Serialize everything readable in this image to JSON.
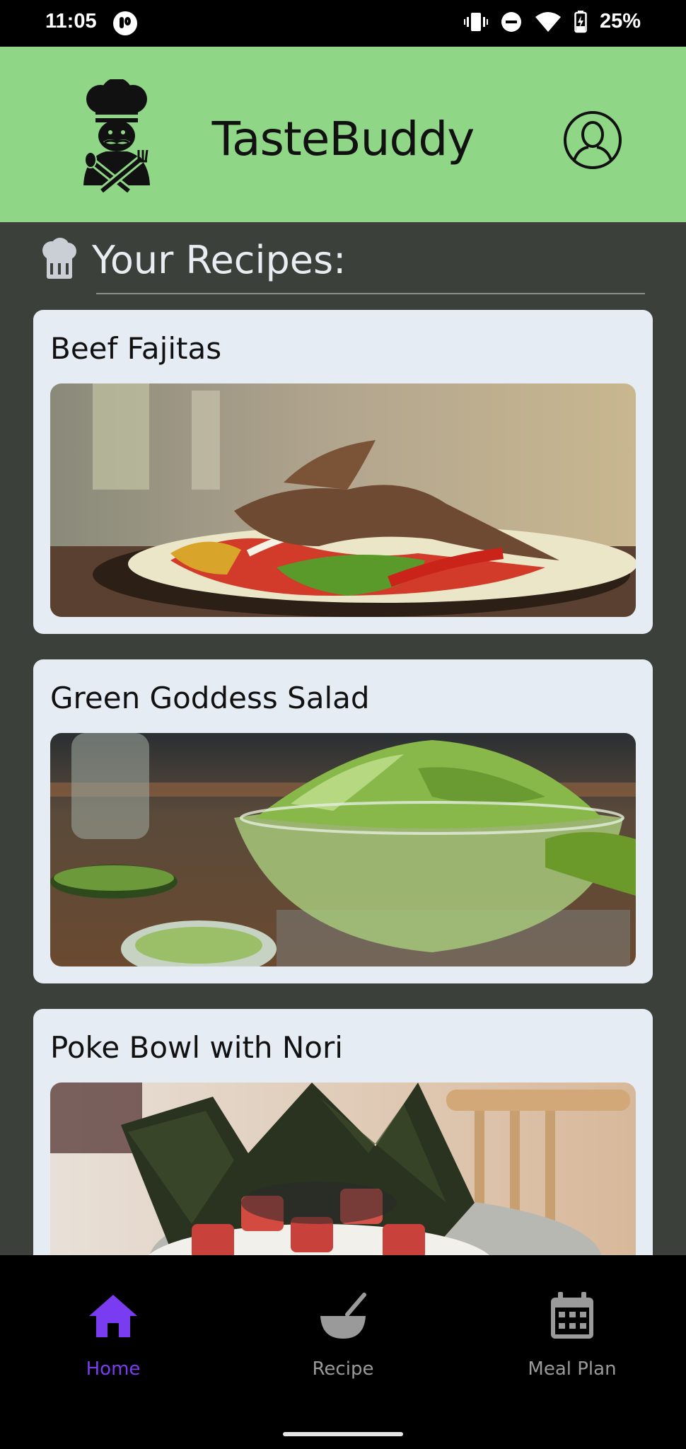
{
  "status_bar": {
    "time": "11:05",
    "battery": "25%",
    "icons": [
      "app-notification-icon",
      "vibrate-icon",
      "do-not-disturb-icon",
      "wifi-icon",
      "battery-charging-icon"
    ]
  },
  "header": {
    "app_title": "TasteBuddy",
    "logo_icon": "chef-logo-icon",
    "profile_icon": "user-profile-icon"
  },
  "main": {
    "section_title": "Your Recipes:",
    "section_icon": "chef-hat-icon",
    "recipes": [
      {
        "title": "Beef Fajitas",
        "image": "beef-fajitas-photo"
      },
      {
        "title": "Green Goddess Salad",
        "image": "green-goddess-salad-photo"
      },
      {
        "title": "Poke Bowl with Nori",
        "image": "poke-bowl-photo"
      }
    ]
  },
  "bottom_nav": {
    "items": [
      {
        "label": "Home",
        "icon": "home-icon",
        "active": true
      },
      {
        "label": "Recipe",
        "icon": "mixing-bowl-icon",
        "active": false
      },
      {
        "label": "Meal Plan",
        "icon": "calendar-icon",
        "active": false
      }
    ]
  },
  "colors": {
    "header_bg": "#8fd786",
    "content_bg": "#3b403b",
    "card_bg": "#e6ecf3",
    "nav_active": "#7a3cf0",
    "nav_inactive": "#9a9a9a"
  }
}
